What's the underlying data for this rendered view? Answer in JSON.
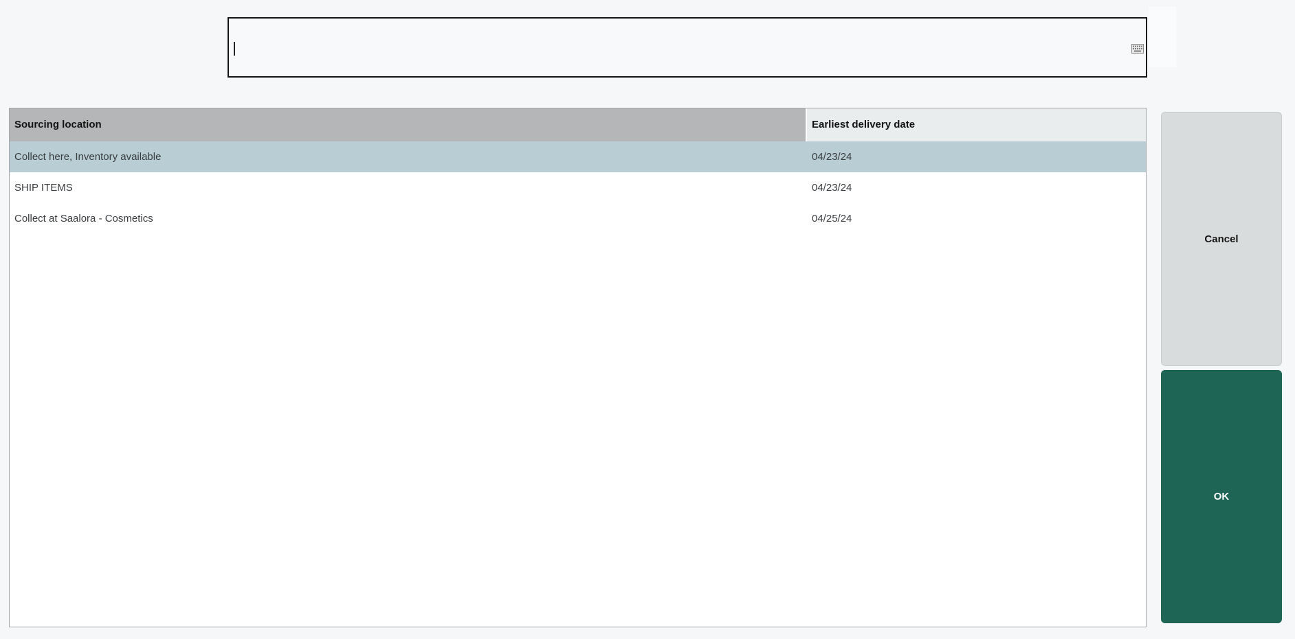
{
  "input": {
    "value": "",
    "placeholder": "",
    "keyboard_icon": "keyboard-icon"
  },
  "table": {
    "columns": [
      {
        "label": "Sourcing location"
      },
      {
        "label": "Earliest delivery date"
      }
    ],
    "rows": [
      {
        "sourcing_location": "Collect here, Inventory available",
        "earliest_delivery_date": "04/23/24",
        "selected": true
      },
      {
        "sourcing_location": "SHIP ITEMS",
        "earliest_delivery_date": "04/23/24",
        "selected": false
      },
      {
        "sourcing_location": "Collect at Saalora - Cosmetics",
        "earliest_delivery_date": "04/25/24",
        "selected": false
      }
    ]
  },
  "buttons": {
    "cancel_label": "Cancel",
    "ok_label": "OK"
  },
  "colors": {
    "page_bg": "#f6f7f9",
    "header_col1_bg": "#b4b6b7",
    "header_col2_bg": "#e9edee",
    "selected_row_bg": "#b9ced4",
    "cancel_bg": "#d9dcdc",
    "ok_bg": "#1e6556",
    "input_border": "#141414"
  }
}
